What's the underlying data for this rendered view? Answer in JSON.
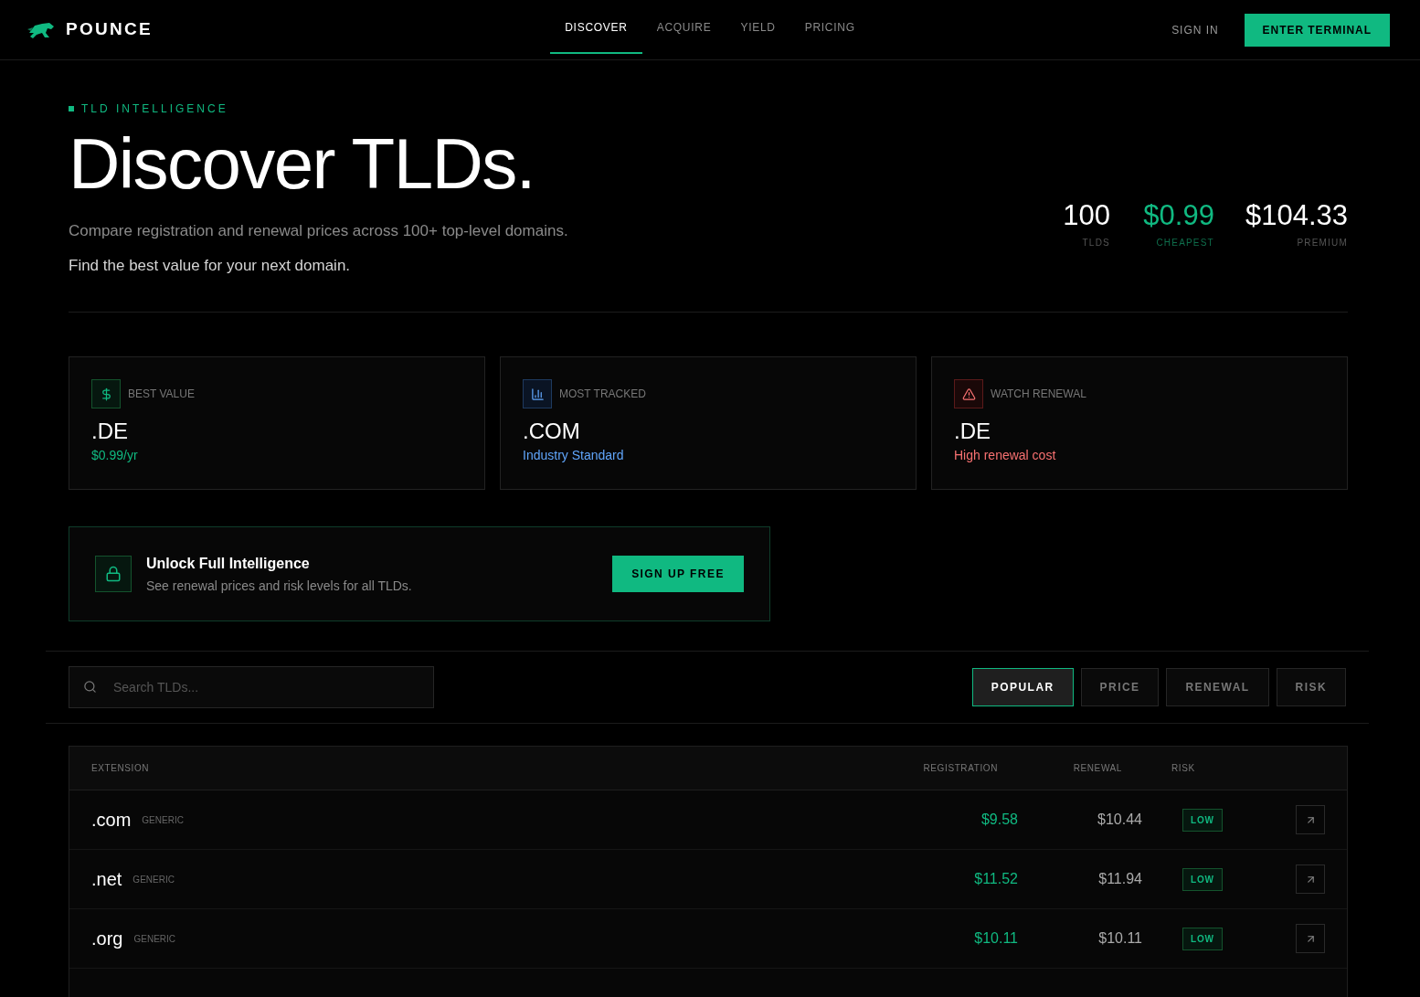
{
  "brand": {
    "name": "POUNCE"
  },
  "nav": [
    {
      "label": "DISCOVER",
      "selected": true
    },
    {
      "label": "ACQUIRE",
      "selected": false
    },
    {
      "label": "YIELD",
      "selected": false
    },
    {
      "label": "PRICING",
      "selected": false
    }
  ],
  "sign_in": "SIGN IN",
  "cta": "ENTER TERMINAL",
  "hero": {
    "eyebrow": "TLD INTELLIGENCE",
    "title": "Discover TLDs.",
    "lead": "Compare registration and renewal prices across 100+ top-level domains.",
    "sub": "Find the best value for your next domain."
  },
  "stats": [
    {
      "value": "100",
      "label": "TLDS",
      "kind": "plain"
    },
    {
      "value": "$0.99",
      "label": "CHEAPEST",
      "kind": "accent"
    },
    {
      "value": "$104.33",
      "label": "PREMIUM",
      "kind": "plain"
    }
  ],
  "highlights": [
    {
      "kind": "value",
      "label": "BEST VALUE",
      "tld": ".DE",
      "note": "$0.99/yr"
    },
    {
      "kind": "tracked",
      "label": "MOST TRACKED",
      "tld": ".COM",
      "note": "Industry Standard"
    },
    {
      "kind": "warning",
      "label": "WATCH RENEWAL",
      "tld": ".DE",
      "note": "High renewal cost"
    }
  ],
  "unlock": {
    "title": "Unlock Full Intelligence",
    "text": "See renewal prices and risk levels for all TLDs.",
    "button": "SIGN UP FREE"
  },
  "search": {
    "placeholder": "Search TLDs..."
  },
  "sort_tabs": [
    {
      "label": "POPULAR",
      "selected": true
    },
    {
      "label": "PRICE",
      "selected": false
    },
    {
      "label": "RENEWAL",
      "selected": false
    },
    {
      "label": "RISK",
      "selected": false
    }
  ],
  "table": {
    "columns": [
      "EXTENSION",
      "REGISTRATION",
      "RENEWAL",
      "RISK"
    ],
    "rows": [
      {
        "extension": ".com",
        "type": "GENERIC",
        "registration": "$9.58",
        "renewal": "$10.44",
        "risk": "LOW"
      },
      {
        "extension": ".net",
        "type": "GENERIC",
        "registration": "$11.52",
        "renewal": "$11.94",
        "risk": "LOW"
      },
      {
        "extension": ".org",
        "type": "GENERIC",
        "registration": "$10.11",
        "renewal": "$10.11",
        "risk": "LOW"
      }
    ]
  }
}
